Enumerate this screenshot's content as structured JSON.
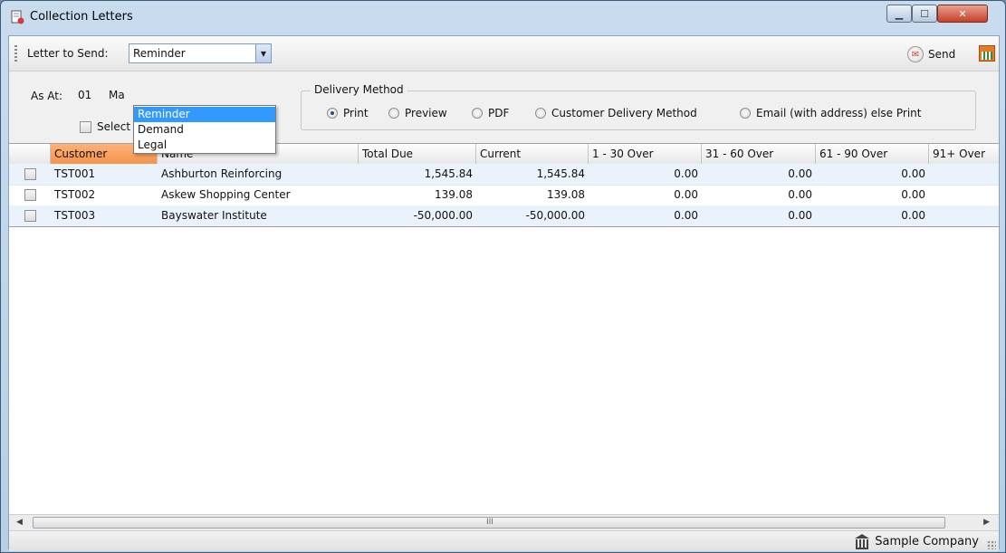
{
  "window": {
    "title": "Collection Letters"
  },
  "toolbar": {
    "letter_label": "Letter to Send:",
    "letter_value": "Reminder",
    "letter_options": [
      "Reminder",
      "Demand",
      "Legal"
    ],
    "send_label": "Send"
  },
  "filters": {
    "as_at_label": "As At:",
    "as_at_day": "01",
    "as_at_month_visible": "Ma",
    "select_all_label": "Select All"
  },
  "delivery": {
    "title": "Delivery Method",
    "options": [
      "Print",
      "Preview",
      "PDF",
      "Customer Delivery Method",
      "Email (with address) else Print"
    ],
    "selected": "Print"
  },
  "grid": {
    "columns": [
      "Customer",
      "Name",
      "Total Due",
      "Current",
      "1 - 30 Over",
      "31 - 60 Over",
      "61 - 90 Over",
      "91+ Over"
    ],
    "active_column": "Customer",
    "rows": [
      {
        "customer": "TST001",
        "name": "Ashburton Reinforcing",
        "total_due": "1,545.84",
        "current": "1,545.84",
        "d1_30": "0.00",
        "d31_60": "0.00",
        "d61_90": "0.00"
      },
      {
        "customer": "TST002",
        "name": "Askew Shopping Center",
        "total_due": "139.08",
        "current": "139.08",
        "d1_30": "0.00",
        "d31_60": "0.00",
        "d61_90": "0.00"
      },
      {
        "customer": "TST003",
        "name": "Bayswater Institute",
        "total_due": "-50,000.00",
        "current": "-50,000.00",
        "d1_30": "0.00",
        "d31_60": "0.00",
        "d61_90": "0.00"
      }
    ]
  },
  "scrollbar": {
    "grip_glyph": "III",
    "left_arrow": "◀",
    "right_arrow": "▶"
  },
  "status": {
    "company": "Sample Company"
  },
  "colors": {
    "active_header": "#f5934a",
    "dropdown_selection": "#3399ff",
    "row_alt": "#eaf2fb"
  }
}
